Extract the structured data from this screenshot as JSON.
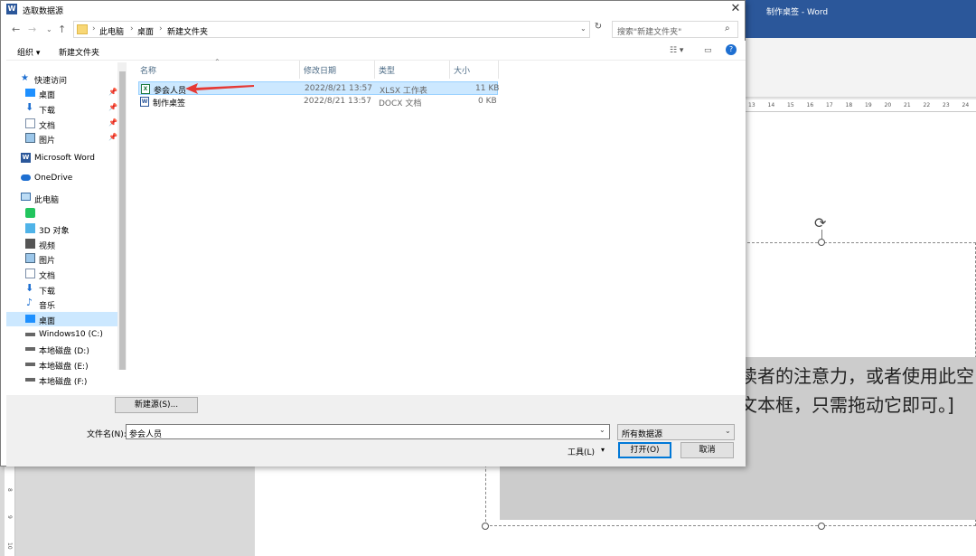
{
  "word": {
    "title": "制作桌签 - Word",
    "ruler_ticks": [
      "13",
      "14",
      "15",
      "16",
      "17",
      "18",
      "19",
      "20",
      "21",
      "22",
      "23",
      "24"
    ],
    "vruler_ticks": [
      "8",
      "9",
      "10"
    ],
    "doc_line1": "读者的注意力，或者使用此空",
    "doc_line2": "文本框，只需拖动它即可。]"
  },
  "dialog": {
    "title": "选取数据源",
    "close": "✕",
    "breadcrumb": [
      "此电脑",
      "桌面",
      "新建文件夹"
    ],
    "search_placeholder": "搜索\"新建文件夹\"",
    "toolbar": {
      "organize": "组织 ▾",
      "new_folder": "新建文件夹"
    },
    "nav": [
      {
        "label": "快速访问",
        "icon": "star-icon"
      },
      {
        "label": "桌面",
        "icon": "desktop-icon",
        "pinned": true
      },
      {
        "label": "下载",
        "icon": "download-icon",
        "pinned": true
      },
      {
        "label": "文档",
        "icon": "document-icon",
        "pinned": true
      },
      {
        "label": "图片",
        "icon": "picture-icon",
        "pinned": true
      },
      {
        "label": "Microsoft Word",
        "icon": "word-icon"
      },
      {
        "label": "OneDrive",
        "icon": "cloud-icon"
      },
      {
        "label": "此电脑",
        "icon": "computer-icon"
      },
      {
        "label": "",
        "icon": "wechat-files-icon"
      },
      {
        "label": "3D 对象",
        "icon": "cube-icon"
      },
      {
        "label": "视频",
        "icon": "video-icon"
      },
      {
        "label": "图片",
        "icon": "picture-icon"
      },
      {
        "label": "文档",
        "icon": "document-icon"
      },
      {
        "label": "下载",
        "icon": "download-icon"
      },
      {
        "label": "音乐",
        "icon": "music-icon"
      },
      {
        "label": "桌面",
        "icon": "desktop-icon"
      },
      {
        "label": "Windows10 (C:)",
        "icon": "drive-icon"
      },
      {
        "label": "本地磁盘 (D:)",
        "icon": "drive-icon"
      },
      {
        "label": "本地磁盘 (E:)",
        "icon": "drive-icon"
      },
      {
        "label": "本地磁盘 (F:)",
        "icon": "drive-icon"
      }
    ],
    "columns": [
      "名称",
      "修改日期",
      "类型",
      "大小"
    ],
    "files": [
      {
        "name": "参会人员",
        "date": "2022/8/21 13:57",
        "type": "XLSX 工作表",
        "size": "11 KB",
        "icon": "excel-file-icon",
        "selected": true
      },
      {
        "name": "制作桌签",
        "date": "2022/8/21 13:57",
        "type": "DOCX 文档",
        "size": "0 KB",
        "icon": "word-file-icon",
        "selected": false
      }
    ],
    "new_source_button": "新建源(S)...",
    "filename_label": "文件名(N):",
    "filename_value": "参会人员",
    "filetype_value": "所有数据源",
    "tools_label": "工具(L)",
    "open_button": "打开(O)",
    "cancel_button": "取消",
    "colors": {
      "accent": "#0078d7",
      "selection": "#cce8ff",
      "word_blue": "#2b579a",
      "arrow": "#e53935"
    }
  }
}
